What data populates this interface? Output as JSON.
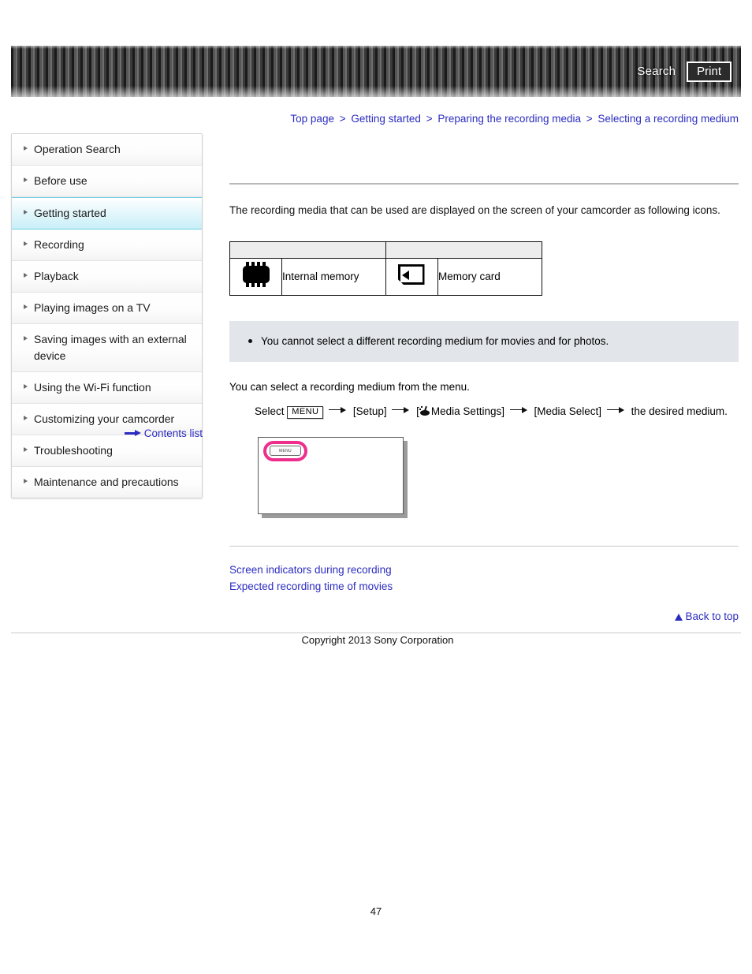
{
  "header": {
    "search_label": "Search",
    "print_label": "Print"
  },
  "breadcrumb": {
    "separator": ">",
    "items": [
      "Top page",
      "Getting started",
      "Preparing the recording media",
      "Selecting a recording medium"
    ]
  },
  "sidebar": {
    "items": [
      {
        "label": "Operation Search",
        "active": false
      },
      {
        "label": "Before use",
        "active": false
      },
      {
        "label": "Getting started",
        "active": true
      },
      {
        "label": "Recording",
        "active": false
      },
      {
        "label": "Playback",
        "active": false
      },
      {
        "label": "Playing images on a TV",
        "active": false
      },
      {
        "label": "Saving images with an external device",
        "active": false
      },
      {
        "label": "Using the Wi-Fi function",
        "active": false
      },
      {
        "label": "Customizing your camcorder",
        "active": false
      },
      {
        "label": "Troubleshooting",
        "active": false
      },
      {
        "label": "Maintenance and precautions",
        "active": false
      }
    ],
    "contents_list_label": "Contents list"
  },
  "main": {
    "intro": "The recording media that can be used are displayed on the screen of your camcorder as following icons.",
    "media_table": {
      "rows": [
        {
          "icon": "chip-icon",
          "label": "Internal memory"
        },
        {
          "icon": "memory-card-icon",
          "label": "Memory card"
        }
      ]
    },
    "note": "You cannot select a different recording medium for movies and for photos.",
    "procedure_lead": "You can select a recording medium from the menu.",
    "procedure": {
      "select_word": "Select",
      "menu_chip": "MENU",
      "step_setup": "[Setup]",
      "step_media_settings_open": "[",
      "step_media_settings": "Media Settings]",
      "step_media_select": "[Media Select]",
      "step_final": "the desired medium."
    },
    "screen_illustration": {
      "menu_button_label": "MENU",
      "highlight_color": "#ee2e8c"
    },
    "related_links": [
      "Screen indicators during recording",
      "Expected recording time of movies"
    ],
    "back_to_top": "Back to top"
  },
  "footer": {
    "copyright": "Copyright 2013 Sony Corporation",
    "page_number": "47"
  },
  "colors": {
    "link": "#2c2cc0",
    "active_nav": "#c9eff8",
    "note_bg": "#e2e5e9",
    "table_head_bg": "#ededed"
  }
}
